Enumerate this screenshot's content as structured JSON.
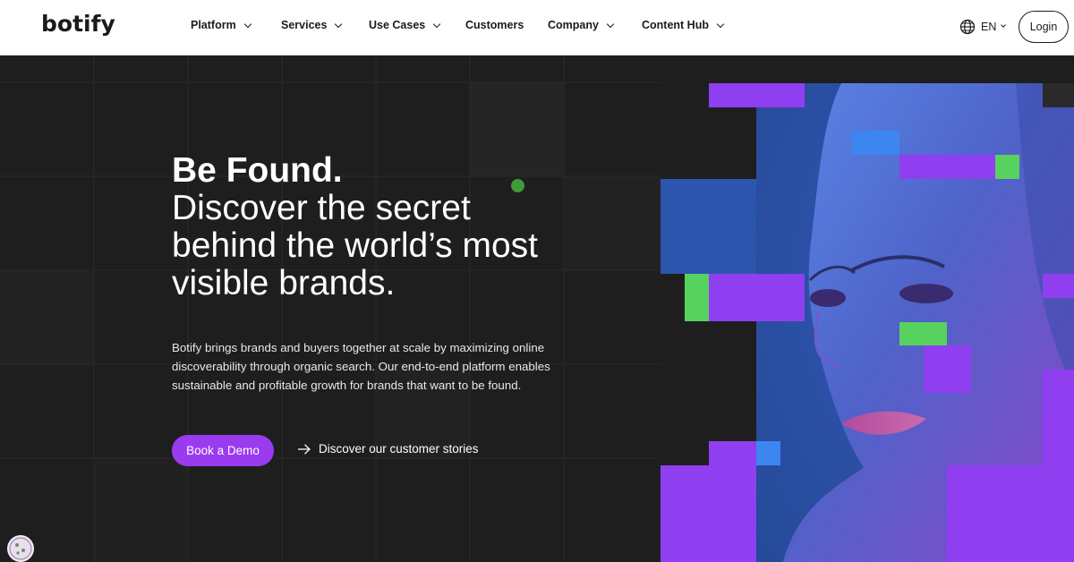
{
  "brand": {
    "name": "botify"
  },
  "nav": {
    "items": [
      {
        "label": "Platform",
        "has_dropdown": true
      },
      {
        "label": "Services",
        "has_dropdown": true
      },
      {
        "label": "Use Cases",
        "has_dropdown": true
      },
      {
        "label": "Customers",
        "has_dropdown": false
      },
      {
        "label": "Company",
        "has_dropdown": true
      },
      {
        "label": "Content Hub",
        "has_dropdown": true
      }
    ],
    "language": "EN",
    "login_label": "Login"
  },
  "hero": {
    "headline_bold": "Be Found.",
    "headline_lines": [
      "Discover the secret",
      "behind the world’s most",
      "visible brands."
    ],
    "description": "Botify brings brands and buyers together at scale by maximizing online discoverability through organic search. Our end-to-end platform enables sustainable and profitable growth for brands that want to be found.",
    "cta_primary": "Book a Demo",
    "cta_secondary": "Discover our customer stories"
  },
  "colors": {
    "accent": "#9b3bf0",
    "dark_bg": "#1e1e1e",
    "purple_block": "#8f3ff0",
    "green_block": "#58d25f",
    "blue_block": "#3d86f0"
  },
  "icons": [
    "globe-icon",
    "chevron-down-icon",
    "arrow-right-icon",
    "cookie-icon"
  ]
}
